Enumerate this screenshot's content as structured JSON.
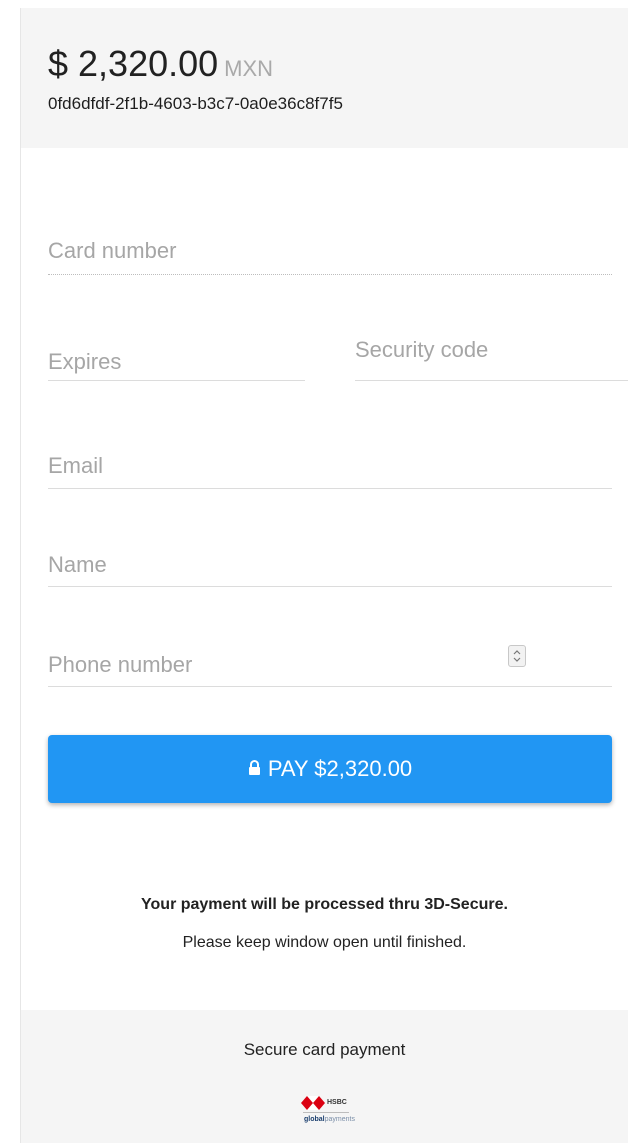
{
  "header": {
    "amount": "$ 2,320.00",
    "currency": "MXN",
    "order_id": "0fd6dfdf-2f1b-4603-b3c7-0a0e36c8f7f5"
  },
  "form": {
    "card_number_placeholder": "Card number",
    "expires_placeholder": "Expires",
    "security_code_placeholder": "Security code",
    "email_placeholder": "Email",
    "name_placeholder": "Name",
    "phone_placeholder": "Phone number"
  },
  "pay_button": {
    "label": "PAY $2,320.00",
    "icon": "lock-icon",
    "color": "#2196f3"
  },
  "notice": {
    "bold": "Your payment will be processed thru 3D-Secure.",
    "text": "Please keep window open until finished."
  },
  "footer": {
    "title": "Secure card payment",
    "logo_primary": "HSBC",
    "logo_secondary_bold": "global",
    "logo_secondary": "payments"
  },
  "colors": {
    "accent": "#2196f3",
    "hsbc_red": "#db0011"
  }
}
